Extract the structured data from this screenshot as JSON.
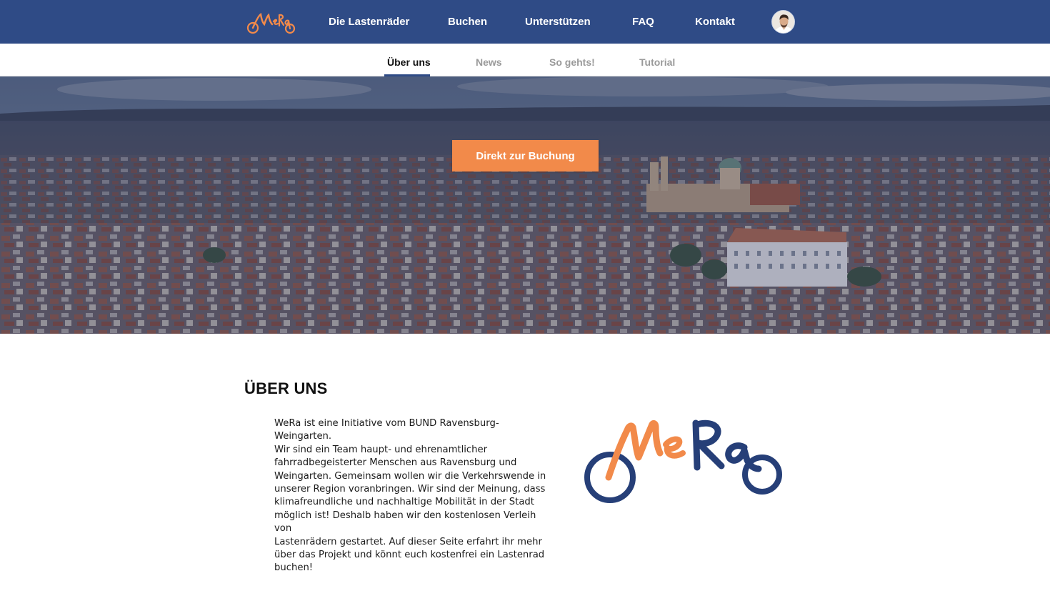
{
  "brand": {
    "logo_text": "WeRa",
    "colors": {
      "navy": "#2f4b86",
      "orange": "#f28a4a",
      "logo_navy": "#263f78"
    }
  },
  "topnav": {
    "items": [
      {
        "label": "Die Lastenräder"
      },
      {
        "label": "Buchen"
      },
      {
        "label": "Unterstützen"
      },
      {
        "label": "FAQ"
      },
      {
        "label": "Kontakt"
      }
    ],
    "avatar_icon": "user-avatar"
  },
  "subnav": {
    "items": [
      {
        "label": "Über uns",
        "active": true
      },
      {
        "label": "News",
        "active": false
      },
      {
        "label": "So gehts!",
        "active": false
      },
      {
        "label": "Tutorial",
        "active": false
      }
    ]
  },
  "hero": {
    "cta_label": "Direkt zur Buchung"
  },
  "about": {
    "title": "ÜBER UNS",
    "lines": [
      "WeRa ist eine Initiative vom BUND Ravensburg-Weingarten.",
      "Wir sind ein Team haupt- und ehrenamtlicher",
      "fahrradbegeisterter Menschen aus Ravensburg und",
      "Weingarten. Gemeinsam wollen wir die Verkehrswende in",
      "unserer Region voranbringen. Wir sind der Meinung, dass",
      "klimafreundliche und nachhaltige Mobilität in der Stadt",
      "möglich ist! Deshalb haben wir den kostenlosen Verleih von",
      "Lastenrädern gestartet. Auf dieser Seite erfahrt ihr mehr",
      "über das Projekt und könnt euch kostenfrei ein Lastenrad",
      "buchen!"
    ]
  }
}
